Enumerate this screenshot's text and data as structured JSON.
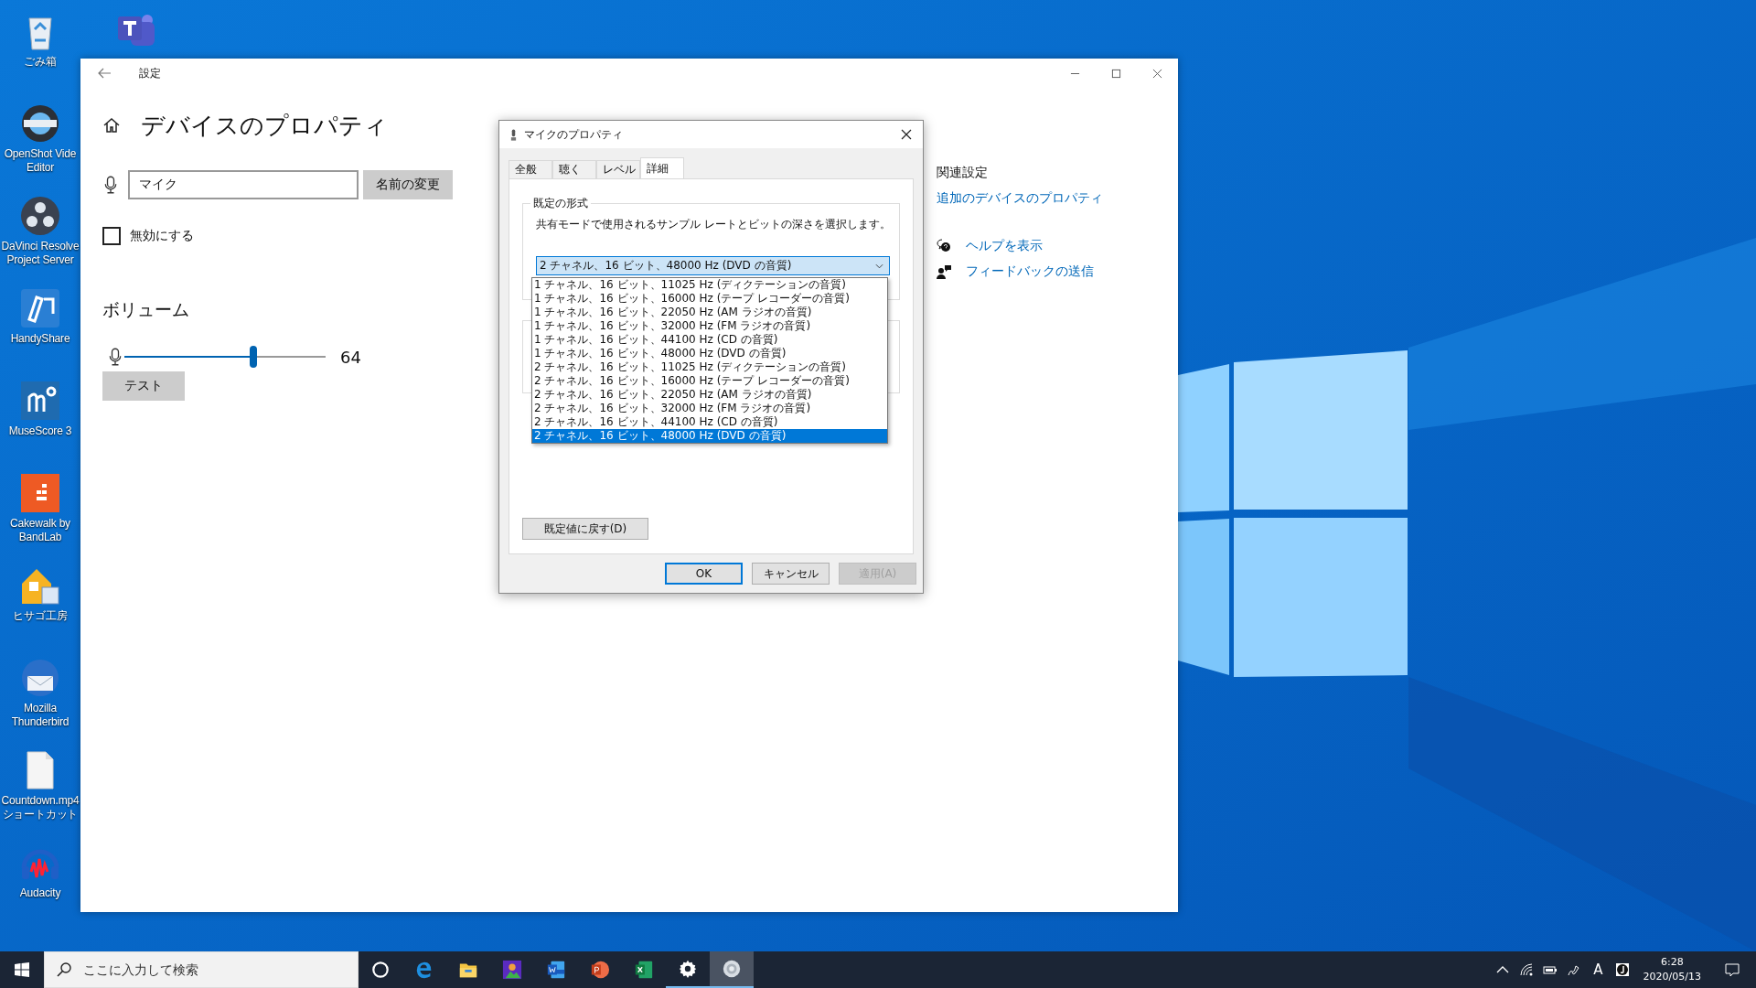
{
  "desktop_icons": [
    {
      "kind": "recycle",
      "label_lines": [
        "ごみ箱"
      ]
    },
    {
      "kind": "openshot",
      "label_lines": [
        "OpenShot Vide",
        "Editor"
      ]
    },
    {
      "kind": "davinci",
      "label_lines": [
        "DaVinci Resolve",
        "Project Server"
      ]
    },
    {
      "kind": "handyshare",
      "label_lines": [
        "HandyShare"
      ]
    },
    {
      "kind": "musescore",
      "label_lines": [
        "MuseScore 3"
      ]
    },
    {
      "kind": "cakewalk",
      "label_lines": [
        "Cakewalk by",
        "BandLab"
      ]
    },
    {
      "kind": "hisago",
      "label_lines": [
        "ヒサゴ工房"
      ]
    },
    {
      "kind": "thunderbird",
      "label_lines": [
        "Mozilla",
        "Thunderbird"
      ]
    },
    {
      "kind": "file",
      "label_lines": [
        "Countdown.mp4",
        "ショートカット"
      ]
    },
    {
      "kind": "audacity",
      "label_lines": [
        "Audacity"
      ]
    }
  ],
  "settings_window": {
    "title": "設定",
    "heading": "デバイスのプロパティ",
    "name_field": {
      "value": "マイク"
    },
    "rename_button": "名前の変更",
    "disable_checkbox": {
      "label": "無効にする",
      "checked": false
    },
    "volume": {
      "heading": "ボリューム",
      "level": 0.64,
      "reading": "64"
    },
    "test_button": "テスト",
    "related": {
      "heading": "関連設定",
      "link": "追加のデバイスのプロパティ"
    },
    "help_links": [
      {
        "kind": "help",
        "label": "ヘルプを表示"
      },
      {
        "kind": "feedback",
        "label": "フィードバックの送信"
      }
    ]
  },
  "dialog": {
    "title": "マイクのプロパティ",
    "tabs": [
      {
        "label": "全般",
        "selected": false
      },
      {
        "label": "聴く",
        "selected": false
      },
      {
        "label": "レベル",
        "selected": false
      },
      {
        "label": "詳細",
        "selected": true
      }
    ],
    "group_label": "既定の形式",
    "description": "共有モードで使用されるサンプル レートとビットの深さを選択します。",
    "format_select": {
      "value": "2 チャネル、16 ビット、48000 Hz (DVD の音質)"
    },
    "format_options": [
      {
        "label": "1 チャネル、16 ビット、11025 Hz (ディクテーションの音質)",
        "selected": false
      },
      {
        "label": "1 チャネル、16 ビット、16000 Hz (テープ レコーダーの音質)",
        "selected": false
      },
      {
        "label": "1 チャネル、16 ビット、22050 Hz (AM ラジオの音質)",
        "selected": false
      },
      {
        "label": "1 チャネル、16 ビット、32000 Hz (FM ラジオの音質)",
        "selected": false
      },
      {
        "label": "1 チャネル、16 ビット、44100 Hz (CD の音質)",
        "selected": false
      },
      {
        "label": "1 チャネル、16 ビット、48000 Hz (DVD の音質)",
        "selected": false
      },
      {
        "label": "2 チャネル、16 ビット、11025 Hz (ディクテーションの音質)",
        "selected": false
      },
      {
        "label": "2 チャネル、16 ビット、16000 Hz (テープ レコーダーの音質)",
        "selected": false
      },
      {
        "label": "2 チャネル、16 ビット、22050 Hz (AM ラジオの音質)",
        "selected": false
      },
      {
        "label": "2 チャネル、16 ビット、32000 Hz (FM ラジオの音質)",
        "selected": false
      },
      {
        "label": "2 チャネル、16 ビット、44100 Hz (CD の音質)",
        "selected": false
      },
      {
        "label": "2 チャネル、16 ビット、48000 Hz (DVD の音質)",
        "selected": true
      }
    ],
    "restore_button": "既定値に戻す(D)",
    "buttons": [
      {
        "label": "OK",
        "kind": "default",
        "disabled": false
      },
      {
        "label": "キャンセル",
        "kind": "normal",
        "disabled": false
      },
      {
        "label": "適用(A)",
        "kind": "normal",
        "disabled": true
      }
    ]
  },
  "taskbar": {
    "search": {
      "placeholder": "ここに入力して検索"
    },
    "apps": [
      {
        "kind": "edge",
        "running": false,
        "selected": false
      },
      {
        "kind": "explorer",
        "running": false,
        "selected": false
      },
      {
        "kind": "picture",
        "running": false,
        "selected": false
      },
      {
        "kind": "word",
        "running": false,
        "selected": false
      },
      {
        "kind": "powerpoint",
        "running": false,
        "selected": false
      },
      {
        "kind": "excel",
        "running": false,
        "selected": false
      },
      {
        "kind": "settings",
        "running": true,
        "selected": false
      },
      {
        "kind": "sound",
        "running": true,
        "selected": true
      }
    ],
    "ime": "A",
    "time": "6:28",
    "date": "2020/05/13"
  }
}
